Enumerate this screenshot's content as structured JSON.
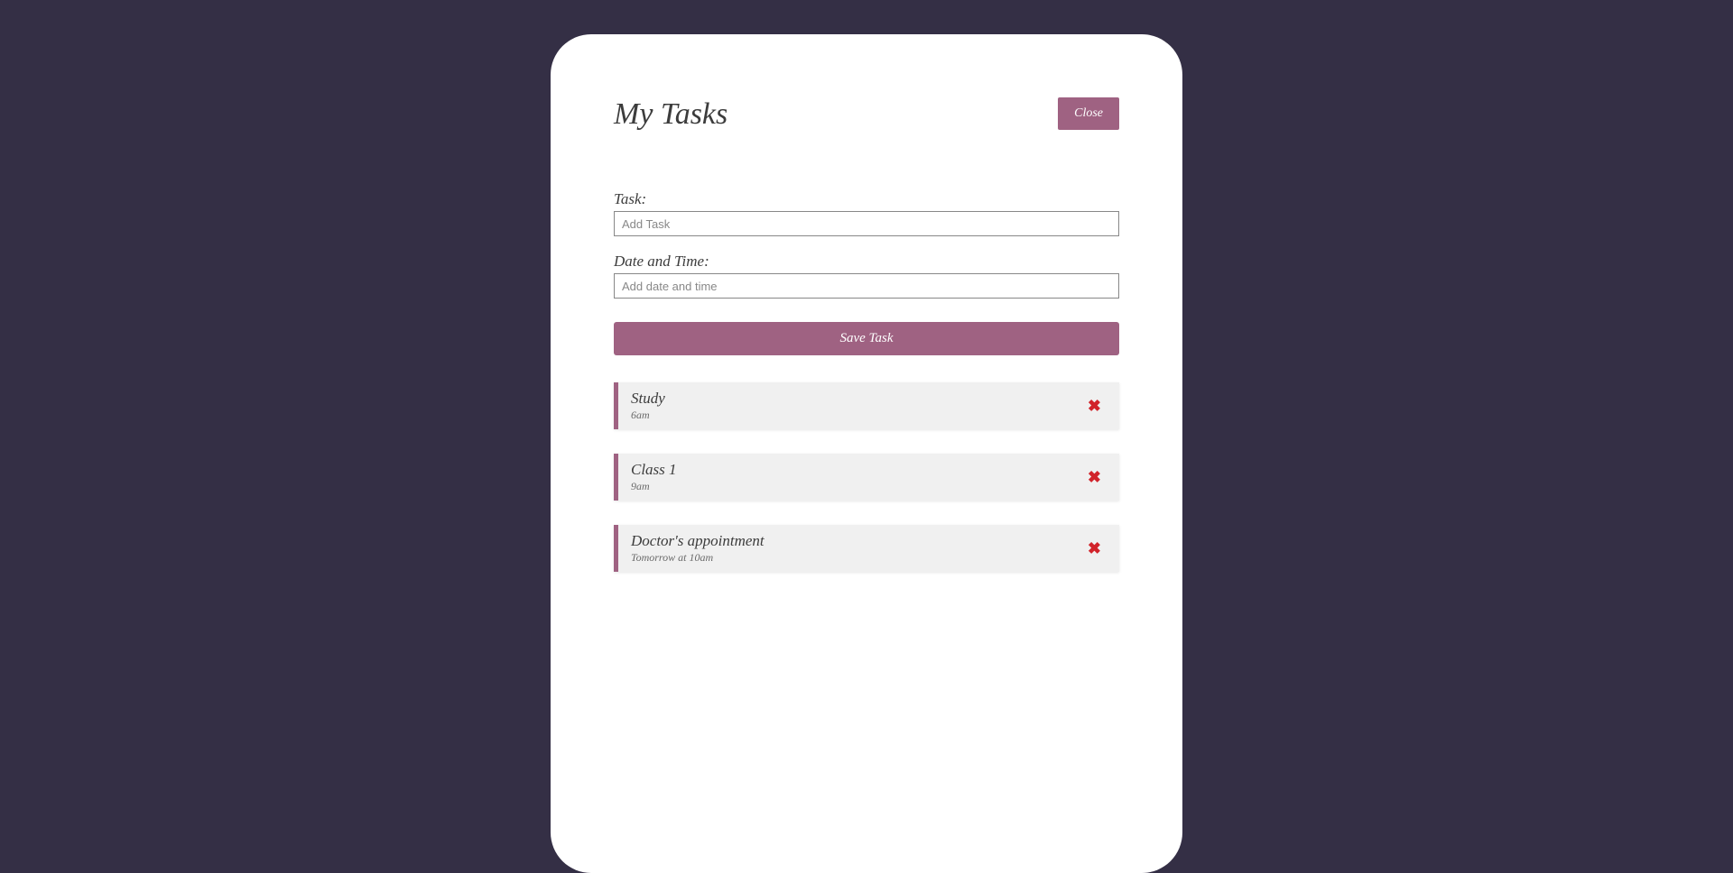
{
  "header": {
    "title": "My Tasks",
    "close_label": "Close"
  },
  "form": {
    "task_label": "Task:",
    "task_placeholder": "Add Task",
    "datetime_label": "Date and Time:",
    "datetime_placeholder": "Add date and time",
    "save_label": "Save Task"
  },
  "tasks": [
    {
      "name": "Study",
      "time": "6am"
    },
    {
      "name": "Class 1",
      "time": "9am"
    },
    {
      "name": "Doctor's appointment",
      "time": "Tomorrow at 10am"
    }
  ],
  "icons": {
    "delete": "✖"
  }
}
